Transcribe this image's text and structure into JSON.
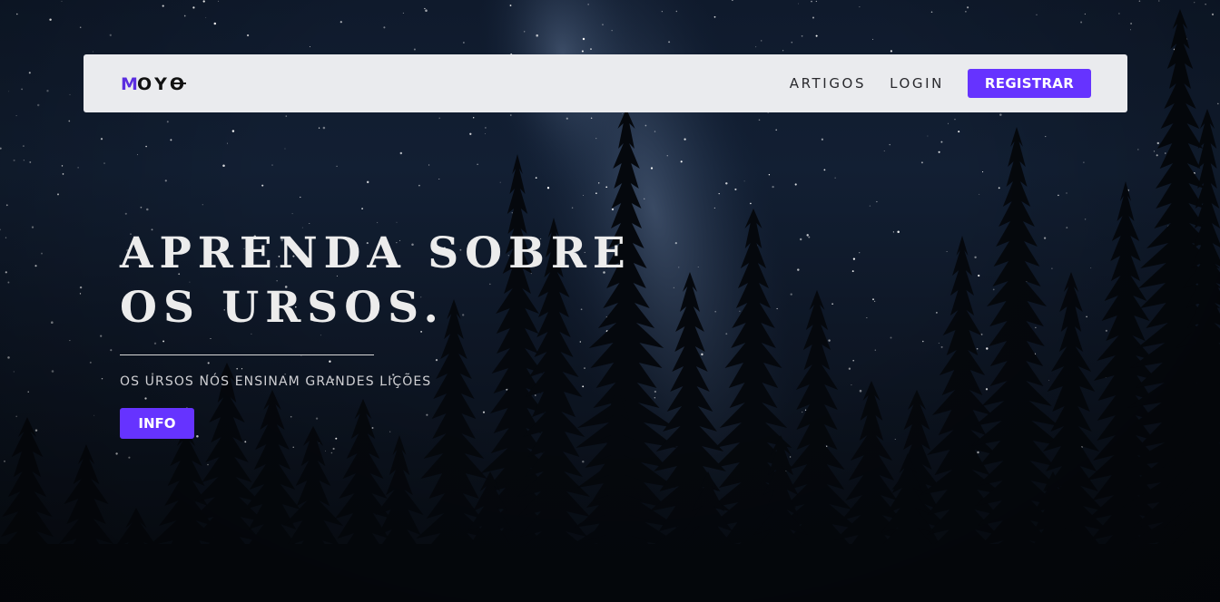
{
  "brand": {
    "logo_text": "MOYO",
    "accent_color": "#6633ff"
  },
  "nav": {
    "links": [
      "ARTIGOS",
      "LOGIN"
    ],
    "register_label": "REGISTRAR"
  },
  "hero": {
    "title_line1": "APRENDA SOBRE",
    "title_line2": "OS URSOS.",
    "subtitle": "OS URSOS NÓS ENSINAM GRANDES LIÇÕES",
    "button_label": "INFO"
  },
  "background": {
    "description_icon": "night-sky-forest-image"
  }
}
